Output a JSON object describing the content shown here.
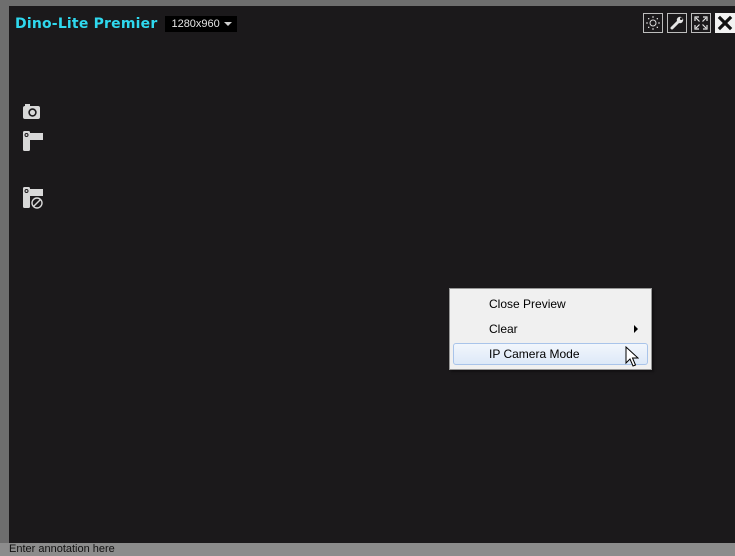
{
  "app": {
    "title": "Dino-Lite Premier",
    "resolution": "1280x960"
  },
  "toolbar": {
    "icons": [
      "brightness-icon",
      "wrench-icon",
      "fullscreen-icon",
      "close-icon"
    ]
  },
  "side_tools": {
    "icons": [
      "camera-icon",
      "video-camera-icon",
      "video-stop-icon"
    ]
  },
  "context_menu": {
    "items": [
      {
        "label": "Close Preview",
        "submenu": false,
        "highlighted": false
      },
      {
        "label": "Clear",
        "submenu": true,
        "highlighted": false
      },
      {
        "label": "IP Camera Mode",
        "submenu": false,
        "highlighted": true
      }
    ]
  },
  "status_bar": {
    "annotation_placeholder": "Enter annotation here"
  },
  "colors": {
    "title": "#2fd8ee",
    "preview_background": "#1b191b",
    "menu_background": "#f0f0f0",
    "menu_highlight_border": "#a9c4ea"
  }
}
